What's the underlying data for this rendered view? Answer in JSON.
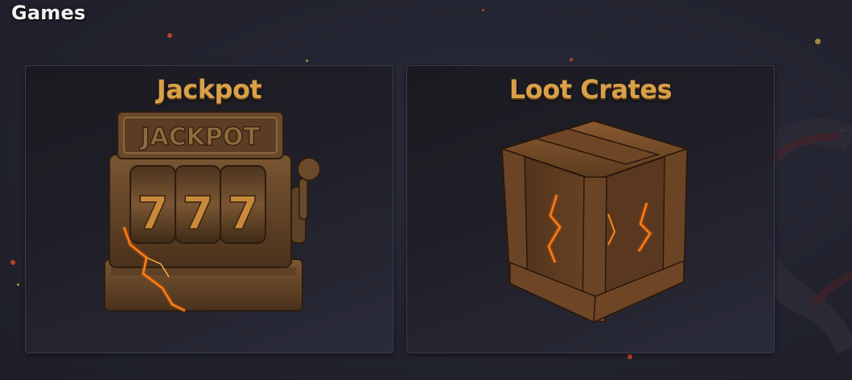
{
  "page": {
    "title": "Games"
  },
  "games": [
    {
      "title": "Jackpot",
      "art": {
        "icon": "slot-machine-icon",
        "sign": "JACKPOT",
        "reels": [
          "7",
          "7",
          "7"
        ]
      }
    },
    {
      "title": "Loot Crates",
      "art": {
        "icon": "loot-crate-icon"
      }
    }
  ],
  "background": {
    "emblem_icon": "dragon-emblem-icon"
  },
  "colors": {
    "background": "#23242f",
    "card": "#1e1d25",
    "card_border": "#3a3b4a",
    "title_text": "#f1f1f1",
    "game_title": "#d9a04a",
    "stone": "#6b4a2c",
    "lava": "#ff8a1e"
  }
}
